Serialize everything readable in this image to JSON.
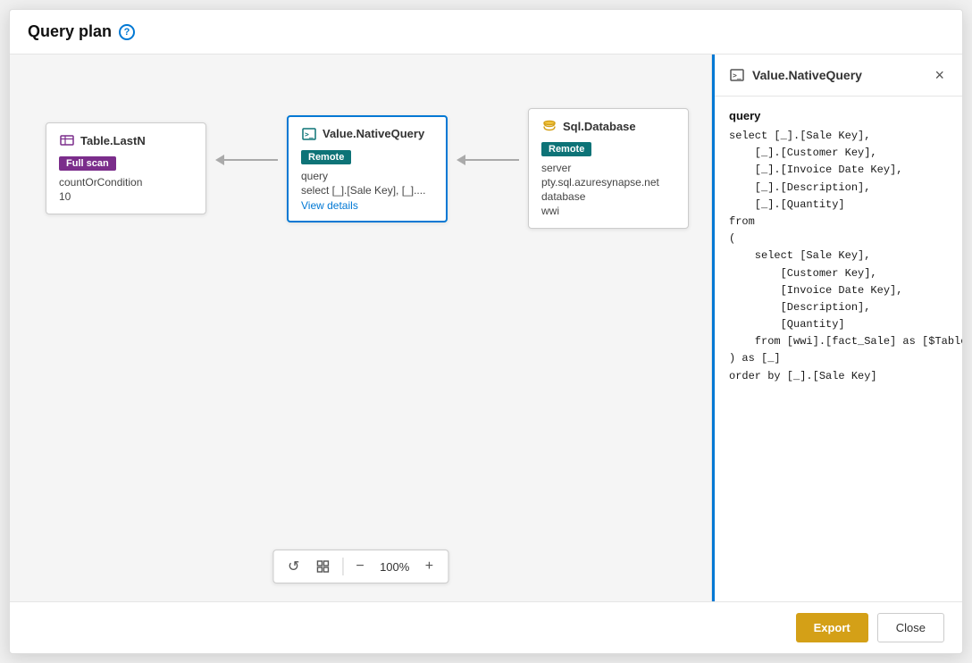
{
  "modal": {
    "title": "Query plan",
    "help_icon": "?",
    "export_label": "Export",
    "close_label": "Close"
  },
  "nodes": [
    {
      "id": "table-lastn",
      "title": "Table.LastN",
      "badge": "Full scan",
      "badge_color": "purple",
      "fields": [
        {
          "label": "countOrCondition"
        },
        {
          "label": "10"
        }
      ],
      "selected": false,
      "has_details": false
    },
    {
      "id": "value-native",
      "title": "Value.NativeQuery",
      "badge": "Remote",
      "badge_color": "teal",
      "fields": [
        {
          "label": "query"
        },
        {
          "label": "select [_].[Sale Key], [_]...."
        }
      ],
      "selected": true,
      "has_details": true,
      "details_label": "View details"
    },
    {
      "id": "sql-database",
      "title": "Sql.Database",
      "badge": "Remote",
      "badge_color": "teal",
      "fields": [
        {
          "label": "server"
        },
        {
          "label": "pty.sql.azuresynapse.net"
        },
        {
          "label": "database"
        },
        {
          "label": "wwi"
        }
      ],
      "selected": false,
      "has_details": false
    }
  ],
  "toolbar": {
    "zoom": "100%",
    "reset_icon": "↺",
    "fit_icon": "⊕",
    "zoom_out_icon": "−",
    "zoom_in_icon": "+"
  },
  "right_panel": {
    "title": "Value.NativeQuery",
    "section_label": "query",
    "query_lines": [
      "select [_].[Sale Key],",
      "    [_].[Customer Key],",
      "    [_].[Invoice Date Key],",
      "    [_].[Description],",
      "    [_].[Quantity]",
      "from",
      "(",
      "    select [Sale Key],",
      "        [Customer Key],",
      "        [Invoice Date Key],",
      "        [Description],",
      "        [Quantity]",
      "    from [wwi].[fact_Sale] as [$Table]",
      ") as [_]",
      "order by [_].[Sale Key]"
    ]
  }
}
